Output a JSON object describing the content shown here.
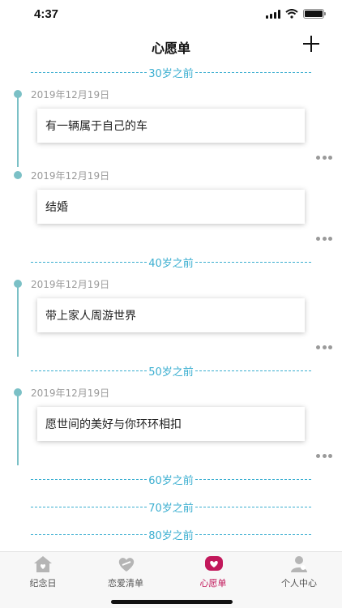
{
  "status_bar": {
    "time": "4:37"
  },
  "nav": {
    "title": "心愿单"
  },
  "sections": [
    {
      "age_label": "30岁之前",
      "wishes": [
        {
          "date": "2019年12月19日",
          "text": "有一辆属于自己的车"
        },
        {
          "date": "2019年12月19日",
          "text": "结婚"
        }
      ]
    },
    {
      "age_label": "40岁之前",
      "wishes": [
        {
          "date": "2019年12月19日",
          "text": "带上家人周游世界"
        }
      ]
    },
    {
      "age_label": "50岁之前",
      "wishes": [
        {
          "date": "2019年12月19日",
          "text": "愿世间的美好与你环环相扣"
        }
      ]
    },
    {
      "age_label": "60岁之前",
      "wishes": []
    },
    {
      "age_label": "70岁之前",
      "wishes": []
    },
    {
      "age_label": "80岁之前",
      "wishes": []
    }
  ],
  "tabs": [
    {
      "label": "纪念日",
      "icon": "house-heart-icon",
      "active": false
    },
    {
      "label": "恋爱清单",
      "icon": "heart-tag-icon",
      "active": false
    },
    {
      "label": "心愿单",
      "icon": "heart-bubble-icon",
      "active": true
    },
    {
      "label": "个人中心",
      "icon": "person-icon",
      "active": false
    }
  ],
  "colors": {
    "accent": "#3aaed0",
    "timeline": "#7bc0c6",
    "active_tab": "#c2185b",
    "inactive_icon": "#b5b5b5"
  }
}
